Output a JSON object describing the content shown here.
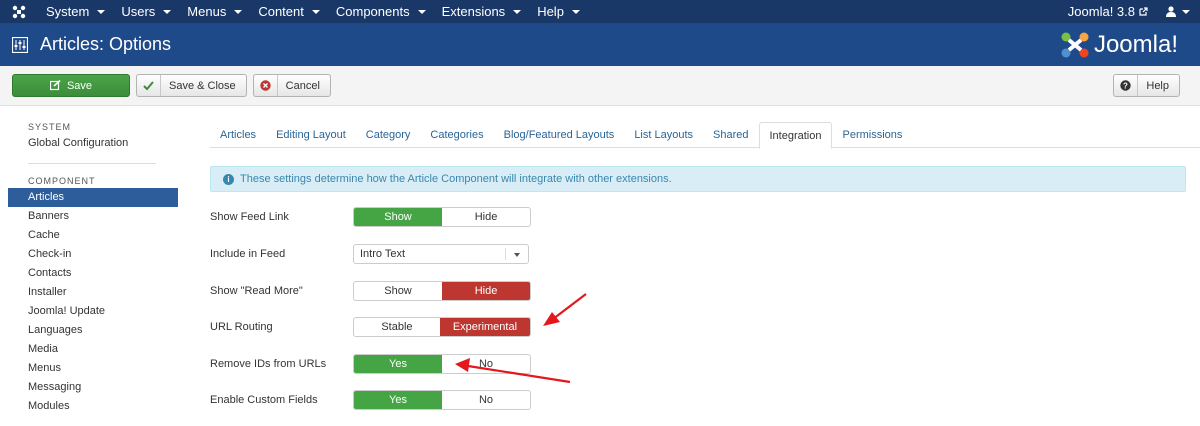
{
  "topnav": {
    "menu": [
      "System",
      "Users",
      "Menus",
      "Content",
      "Components",
      "Extensions",
      "Help"
    ],
    "version": "Joomla! 3.8"
  },
  "header": {
    "title": "Articles: Options",
    "brand": "Joomla!"
  },
  "toolbar": {
    "save": "Save",
    "save_close": "Save & Close",
    "cancel": "Cancel",
    "help": "Help"
  },
  "sidebar": {
    "system_heading": "SYSTEM",
    "global_config": "Global Configuration",
    "component_heading": "COMPONENT",
    "items": [
      "Articles",
      "Banners",
      "Cache",
      "Check-in",
      "Contacts",
      "Installer",
      "Joomla! Update",
      "Languages",
      "Media",
      "Menus",
      "Messaging",
      "Modules"
    ],
    "active": "Articles"
  },
  "tabs": [
    "Articles",
    "Editing Layout",
    "Category",
    "Categories",
    "Blog/Featured Layouts",
    "List Layouts",
    "Shared",
    "Integration",
    "Permissions"
  ],
  "active_tab": "Integration",
  "info": "These settings determine how the Article Component will integrate with other extensions.",
  "fields": {
    "show_feed_link": {
      "label": "Show Feed Link",
      "opt1": "Show",
      "opt2": "Hide",
      "selected": "Show"
    },
    "include_in_feed": {
      "label": "Include in Feed",
      "value": "Intro Text"
    },
    "show_read_more": {
      "label": "Show \"Read More\"",
      "opt1": "Show",
      "opt2": "Hide",
      "selected": "Hide"
    },
    "url_routing": {
      "label": "URL Routing",
      "opt1": "Stable",
      "opt2": "Experimental",
      "selected": "Experimental"
    },
    "remove_ids": {
      "label": "Remove IDs from URLs",
      "opt1": "Yes",
      "opt2": "No",
      "selected": "Yes"
    },
    "custom_fields": {
      "label": "Enable Custom Fields",
      "opt1": "Yes",
      "opt2": "No",
      "selected": "Yes"
    }
  },
  "colors": {
    "nav": "#1a3867",
    "header": "#1f4a8a",
    "success": "#45a545",
    "danger": "#bd362f",
    "arrow": "#e3171c"
  }
}
